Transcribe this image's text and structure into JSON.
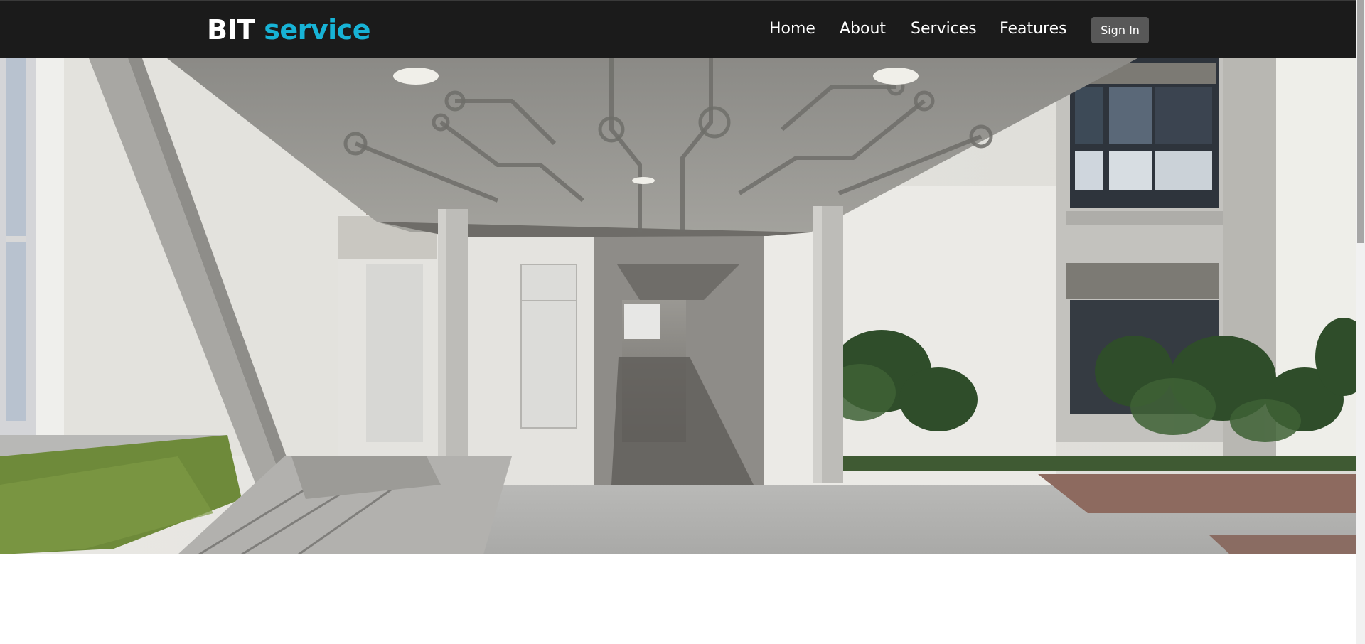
{
  "brand": {
    "part1": "BIT",
    "part2": "service"
  },
  "nav": {
    "home": "Home",
    "about": "About",
    "services": "Services",
    "features": "Features",
    "signin": "Sign In"
  },
  "colors": {
    "navbar_bg": "#1b1b1b",
    "brand_accent": "#17b3d6",
    "signin_bg": "#585858"
  },
  "hero": {
    "image": "courtyard-building-photo"
  }
}
